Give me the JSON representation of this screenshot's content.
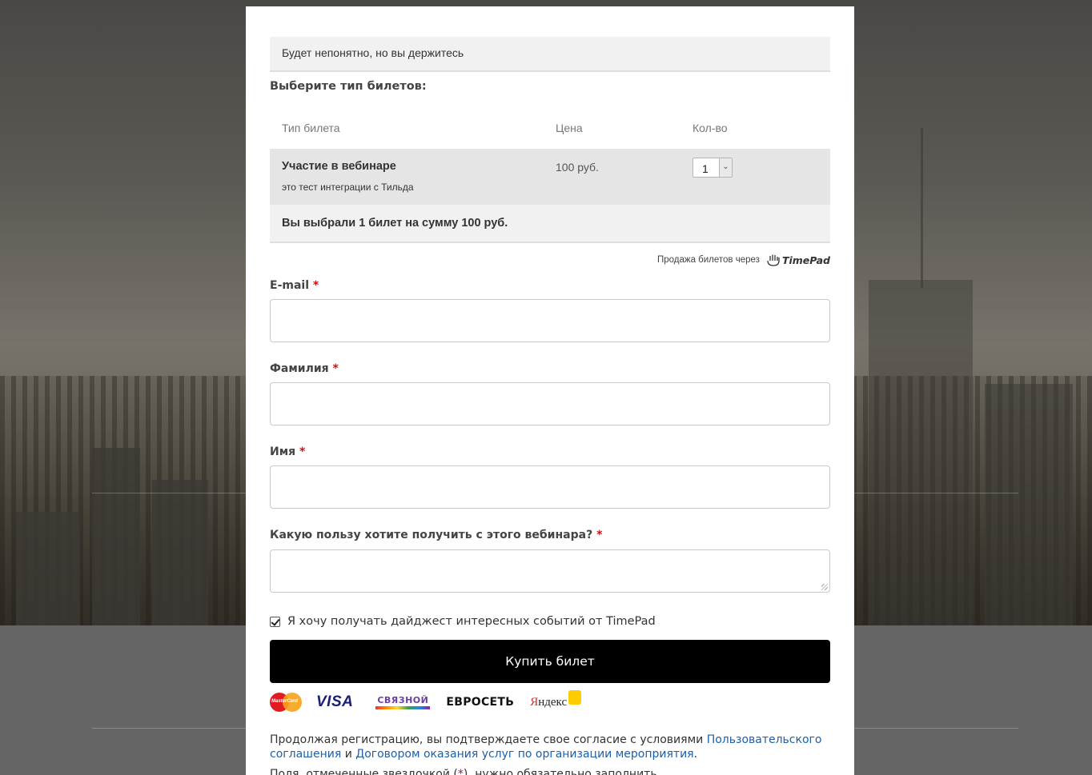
{
  "event": {
    "title": "Будет непонятно, но вы держитесь"
  },
  "tickets": {
    "section_title": "Выберите тип билетов:",
    "columns": [
      "Тип билета",
      "Цена",
      "Кол-во"
    ],
    "rows": [
      {
        "name": "Участие в вебинаре",
        "description": "это тест интеграции с Тильда",
        "price": "100 руб.",
        "quantity": "1"
      }
    ],
    "summary": "Вы выбрали 1 билет на сумму 100 руб."
  },
  "powered_by": {
    "text": "Продажа билетов через",
    "brand": "TimePad"
  },
  "form": {
    "required_mark": "*",
    "fields": [
      {
        "label": "E-mail",
        "value": ""
      },
      {
        "label": "Фамилия",
        "value": ""
      },
      {
        "label": "Имя",
        "value": ""
      },
      {
        "label": "Какую пользу хотите получить с этого вебинара?",
        "value": ""
      }
    ],
    "digest_checkbox": {
      "label": "Я хочу получать дайджест интересных событий от TimePad",
      "checked": true
    },
    "buy_button": "Купить билет"
  },
  "payments": {
    "icons": [
      "mastercard-logo",
      "visa-logo",
      "svyaznoy-logo",
      "euroset-logo",
      "yandex-money-logo"
    ],
    "mastercard": "MasterCard",
    "visa": "VISA",
    "svyaznoy": "СВЯЗНОЙ",
    "euroset": "ЕВРОСЕТЬ",
    "yandex_y": "Я",
    "yandex_rest": "ндекс"
  },
  "consent": {
    "prefix": "Продолжая регистрацию, вы подтверждаете свое согласие с условиями ",
    "link1": "Пользовательского соглашения",
    "middle": " и ",
    "link2": "Договором оказания услуг по организации мероприятия",
    "suffix": "."
  },
  "note": {
    "prefix": "Поля, отмеченные звездочкой (",
    "mark": "*",
    "suffix": "), нужно обязательно заполнить."
  },
  "colors": {
    "required": "#c0151a",
    "link": "#1d5fa7",
    "button": "#000000"
  }
}
